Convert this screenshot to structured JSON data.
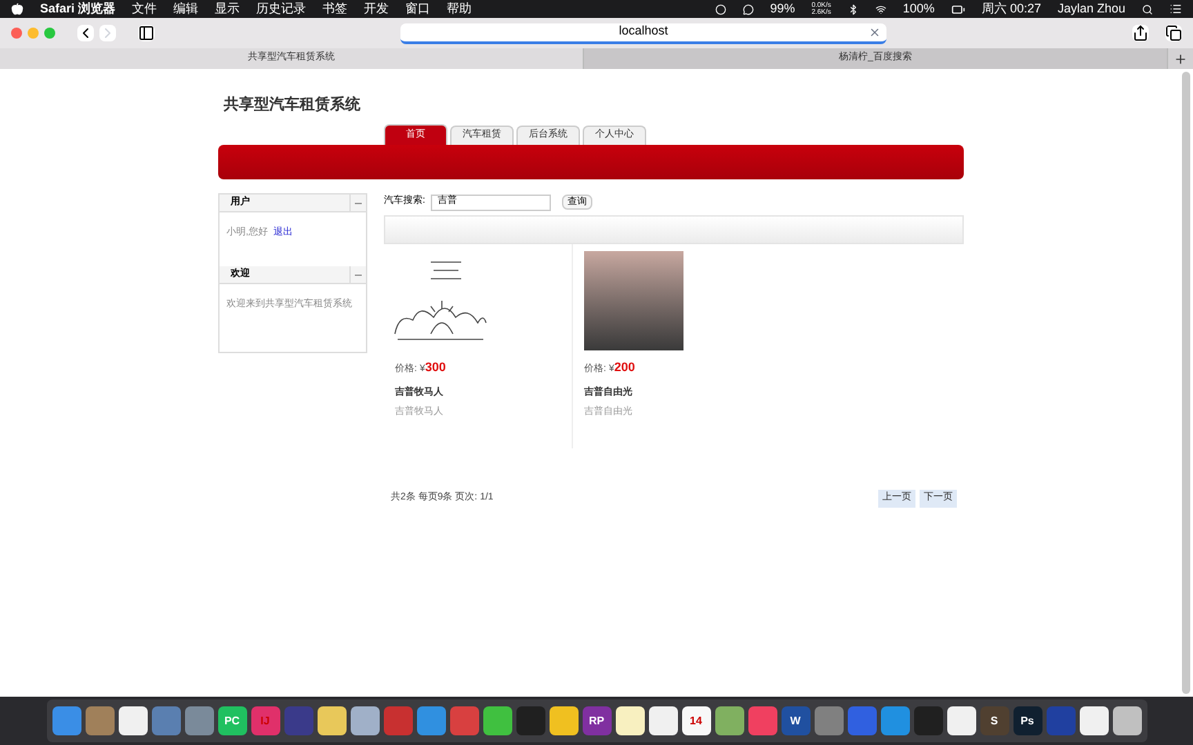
{
  "menu_bar": {
    "app": "Safari 浏览器",
    "menus": [
      "文件",
      "编辑",
      "显示",
      "历史记录",
      "书签",
      "开发",
      "窗口",
      "帮助"
    ],
    "status": {
      "cpu": "99%",
      "net_up": "0.0K/s",
      "net_down": "2.6K/s",
      "battery": "100%",
      "clock": "周六 00:27",
      "user": "Jaylan Zhou"
    }
  },
  "address_bar": {
    "value": "localhost"
  },
  "browser_tabs": [
    {
      "label": "共享型汽车租赁系统",
      "selected": true
    },
    {
      "label": "杨清柠_百度搜索",
      "selected": false
    }
  ],
  "page": {
    "title": "共享型汽车租赁系统",
    "nav_tabs": [
      {
        "label": "首页",
        "selected": true
      },
      {
        "label": "汽车租赁",
        "selected": false
      },
      {
        "label": "后台系统",
        "selected": false
      },
      {
        "label": "个人中心",
        "selected": false
      }
    ],
    "sidebar": [
      {
        "title": "用户",
        "text": "小明,您好",
        "link": "退出"
      },
      {
        "title": "欢迎",
        "text": "欢迎来到共享型汽车租赁系统"
      }
    ],
    "search": {
      "label": "汽车搜索:",
      "value": "吉普",
      "button": "查询"
    },
    "products": [
      {
        "kind": "sketch",
        "price_label": "价格:",
        "currency": "¥",
        "price": "300",
        "name": "吉普牧马人",
        "desc": "吉普牧马人"
      },
      {
        "kind": "photo",
        "price_label": "价格:",
        "currency": "¥",
        "price": "200",
        "name": "吉普自由光",
        "desc": "吉普自由光"
      }
    ],
    "pagination": {
      "summary": "共2条 每页9条 页次: 1/1",
      "prev": "上一页",
      "next": "下一页"
    }
  },
  "dock": [
    {
      "color": "#3a8ee6"
    },
    {
      "color": "#a0805a"
    },
    {
      "color": "#f0f0f0"
    },
    {
      "color": "#5a7fb0"
    },
    {
      "color": "#7a8a9a"
    },
    {
      "color": "#20c060",
      "label": "PC"
    },
    {
      "color": "#e0306a",
      "label": "IJ"
    },
    {
      "color": "#3a3a8a"
    },
    {
      "color": "#e8c85a"
    },
    {
      "color": "#a0b0c8"
    },
    {
      "color": "#c83030"
    },
    {
      "color": "#3090e0"
    },
    {
      "color": "#d84040"
    },
    {
      "color": "#40c040"
    },
    {
      "color": "#202020"
    },
    {
      "color": "#f0c020"
    },
    {
      "color": "#8030a0",
      "label": "RP"
    },
    {
      "color": "#f8f0c0"
    },
    {
      "color": "#f0f0f0"
    },
    {
      "color": "#f8f8f8",
      "label": "14"
    },
    {
      "color": "#80b060"
    },
    {
      "color": "#f04060"
    },
    {
      "color": "#2050a0",
      "label": "W"
    },
    {
      "color": "#808080"
    },
    {
      "color": "#3060e0"
    },
    {
      "color": "#2090e0"
    },
    {
      "color": "#202020"
    },
    {
      "color": "#f0f0f0"
    },
    {
      "color": "#504030",
      "label": "S"
    },
    {
      "color": "#102030",
      "label": "Ps"
    },
    {
      "color": "#2040a0"
    },
    {
      "color": "#f0f0f0"
    },
    {
      "color": "#c0c0c0"
    }
  ]
}
